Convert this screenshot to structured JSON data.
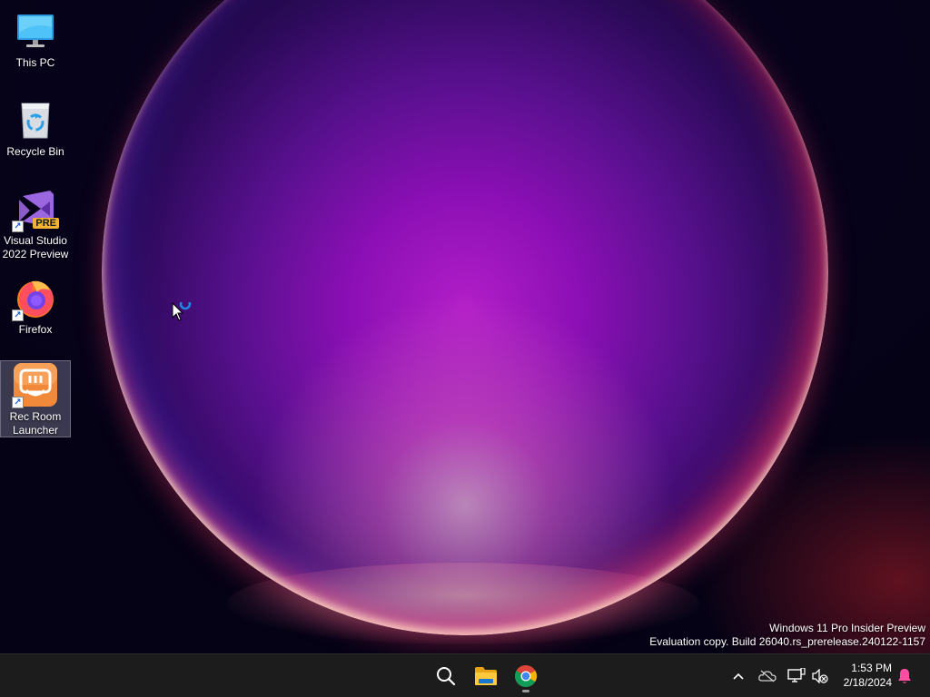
{
  "desktop": {
    "icons": [
      {
        "label": "This PC"
      },
      {
        "label": "Recycle Bin"
      },
      {
        "label_line1": "Visual Studio",
        "label_line2": "2022 Preview",
        "badge": "PRE"
      },
      {
        "label": "Firefox"
      },
      {
        "label_line1": "Rec Room",
        "label_line2": "Launcher",
        "selected": true
      }
    ]
  },
  "watermark": {
    "line1": "Windows 11 Pro Insider Preview",
    "line2": "Evaluation copy. Build 26040.rs_prerelease.240122-1157"
  },
  "taskbar": {
    "apps": [
      {
        "name": "search-icon"
      },
      {
        "name": "file-explorer-icon"
      },
      {
        "name": "chrome-icon",
        "running": true
      }
    ],
    "tray": {
      "icons": [
        "chevron-up-icon",
        "onedrive-offline-icon",
        "network-icon",
        "volume-muted-icon",
        "notification-bell-icon"
      ],
      "time": "1:53 PM",
      "date": "2/18/2024"
    }
  },
  "colors": {
    "taskbar_bg": "#1c1c1c",
    "orb_magenta": "#b21ec8",
    "bell_accent": "#ff4fa3"
  }
}
